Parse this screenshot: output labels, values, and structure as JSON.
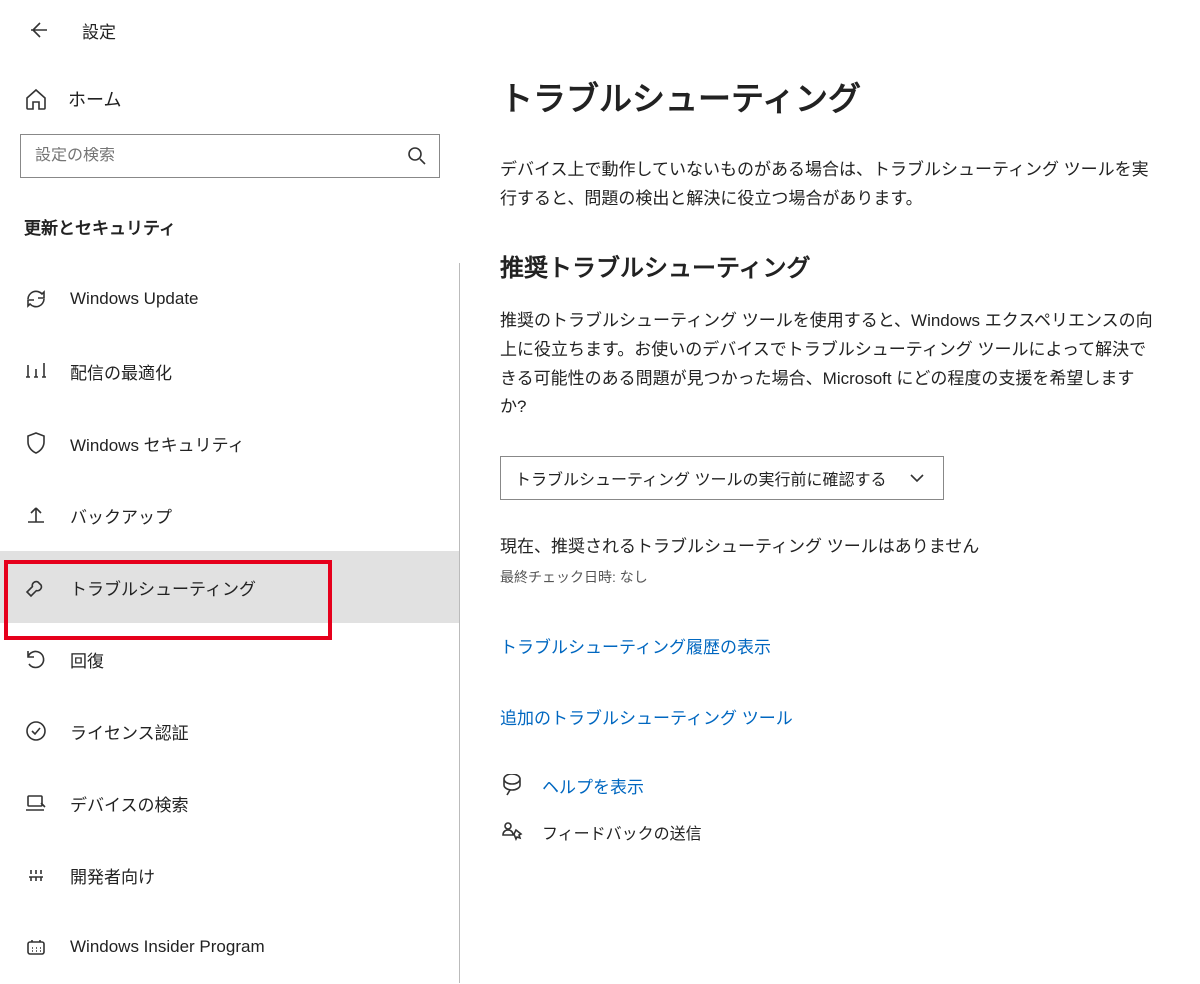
{
  "header": {
    "title": "設定"
  },
  "sidebar": {
    "home_label": "ホーム",
    "search_placeholder": "設定の検索",
    "category_label": "更新とセキュリティ",
    "items": [
      {
        "label": "Windows Update"
      },
      {
        "label": "配信の最適化"
      },
      {
        "label": "Windows セキュリティ"
      },
      {
        "label": "バックアップ"
      },
      {
        "label": "トラブルシューティング"
      },
      {
        "label": "回復"
      },
      {
        "label": "ライセンス認証"
      },
      {
        "label": "デバイスの検索"
      },
      {
        "label": "開発者向け"
      },
      {
        "label": "Windows Insider Program"
      }
    ]
  },
  "main": {
    "title": "トラブルシューティング",
    "intro": "デバイス上で動作していないものがある場合は、トラブルシューティング ツールを実行すると、問題の検出と解決に役立つ場合があります。",
    "section1_title": "推奨トラブルシューティング",
    "section1_body": "推奨のトラブルシューティング ツールを使用すると、Windows エクスペリエンスの向上に役立ちます。お使いのデバイスでトラブルシューティング ツールによって解決できる可能性のある問題が見つかった場合、Microsoft にどの程度の支援を希望しますか?",
    "select_value": "トラブルシューティング ツールの実行前に確認する",
    "no_recommended": "現在、推奨されるトラブルシューティング ツールはありません",
    "last_check": "最終チェック日時: なし",
    "history_link": "トラブルシューティング履歴の表示",
    "additional_link": "追加のトラブルシューティング ツール",
    "help_link": "ヘルプを表示",
    "feedback_link": "フィードバックの送信"
  }
}
